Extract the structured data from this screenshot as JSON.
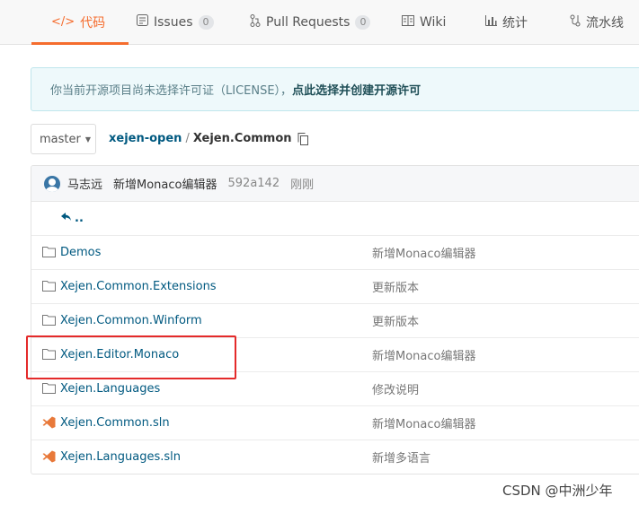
{
  "tabs": [
    {
      "label": "代码",
      "icon": "code-icon",
      "active": true
    },
    {
      "label": "Issues",
      "icon": "issues-icon",
      "badge": "0"
    },
    {
      "label": "Pull Requests",
      "icon": "pull-request-icon",
      "badge": "0"
    },
    {
      "label": "Wiki",
      "icon": "wiki-icon"
    },
    {
      "label": "统计",
      "icon": "stats-icon"
    },
    {
      "label": "流水线",
      "icon": "pipeline-icon"
    }
  ],
  "banner": {
    "text": "你当前开源项目尚未选择许可证（LICENSE），",
    "link": "点此选择并创建开源许可"
  },
  "branch": {
    "label": "master"
  },
  "breadcrumb": {
    "owner": "xejen-open",
    "separator": "/",
    "repo": "Xejen.Common"
  },
  "commit": {
    "author": "马志远",
    "message": "新增Monaco编辑器",
    "sha": "592a142",
    "time": "刚刚"
  },
  "parent_link": "..",
  "files": [
    {
      "name": "Demos",
      "type": "folder",
      "commit": "新增Monaco编辑器"
    },
    {
      "name": "Xejen.Common.Extensions",
      "type": "folder",
      "commit": "更新版本"
    },
    {
      "name": "Xejen.Common.Winform",
      "type": "folder",
      "commit": "更新版本"
    },
    {
      "name": "Xejen.Editor.Monaco",
      "type": "folder",
      "commit": "新增Monaco编辑器"
    },
    {
      "name": "Xejen.Languages",
      "type": "folder",
      "commit": "修改说明"
    },
    {
      "name": "Xejen.Common.sln",
      "type": "visual-studio-solution",
      "commit": "新增Monaco编辑器"
    },
    {
      "name": "Xejen.Languages.sln",
      "type": "visual-studio-solution",
      "commit": "新增多语言"
    }
  ],
  "watermark": "CSDN @中洲少年",
  "colors": {
    "accent": "#f56c2d",
    "link": "#005980",
    "highlight": "#e42a2a",
    "vs_icon": "#e8793a"
  }
}
